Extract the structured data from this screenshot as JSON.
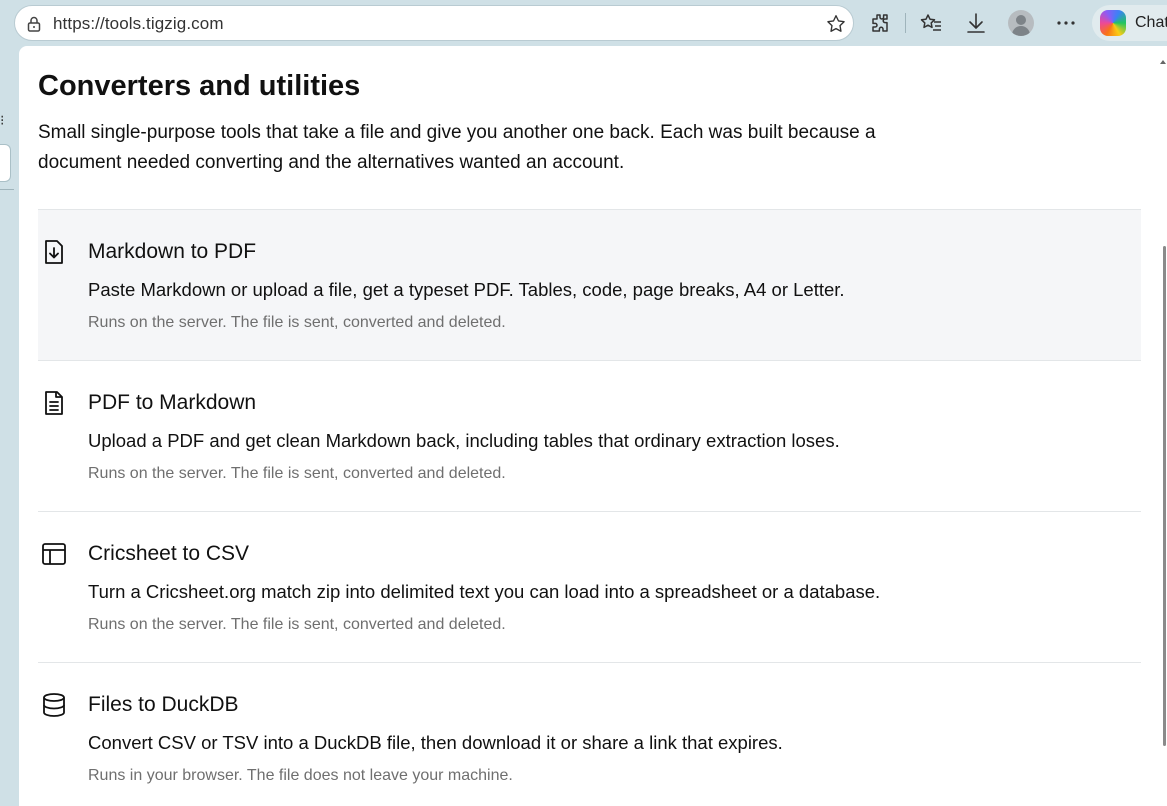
{
  "browser": {
    "url": "https://tools.tigzig.com",
    "copilot_label": "Chat"
  },
  "page": {
    "title": "Converters and utilities",
    "description": "Small single-purpose tools that take a file and give you another one back. Each was built because a document needed converting and the alternatives wanted an account."
  },
  "tools": [
    {
      "name": "Markdown to PDF",
      "description": "Paste Markdown or upload a file, get a typeset PDF. Tables, code, page breaks, A4 or Letter.",
      "note": "Runs on the server. The file is sent, converted and deleted.",
      "icon": "file-download-icon"
    },
    {
      "name": "PDF to Markdown",
      "description": "Upload a PDF and get clean Markdown back, including tables that ordinary extraction loses.",
      "note": "Runs on the server. The file is sent, converted and deleted.",
      "icon": "file-text-icon"
    },
    {
      "name": "Cricsheet to CSV",
      "description": "Turn a Cricsheet.org match zip into delimited text you can load into a spreadsheet or a database.",
      "note": "Runs on the server. The file is sent, converted and deleted.",
      "icon": "table-icon"
    },
    {
      "name": "Files to DuckDB",
      "description": "Convert CSV or TSV into a DuckDB file, then download it or share a link that expires.",
      "note": "Runs in your browser. The file does not leave your machine.",
      "icon": "database-icon"
    }
  ]
}
